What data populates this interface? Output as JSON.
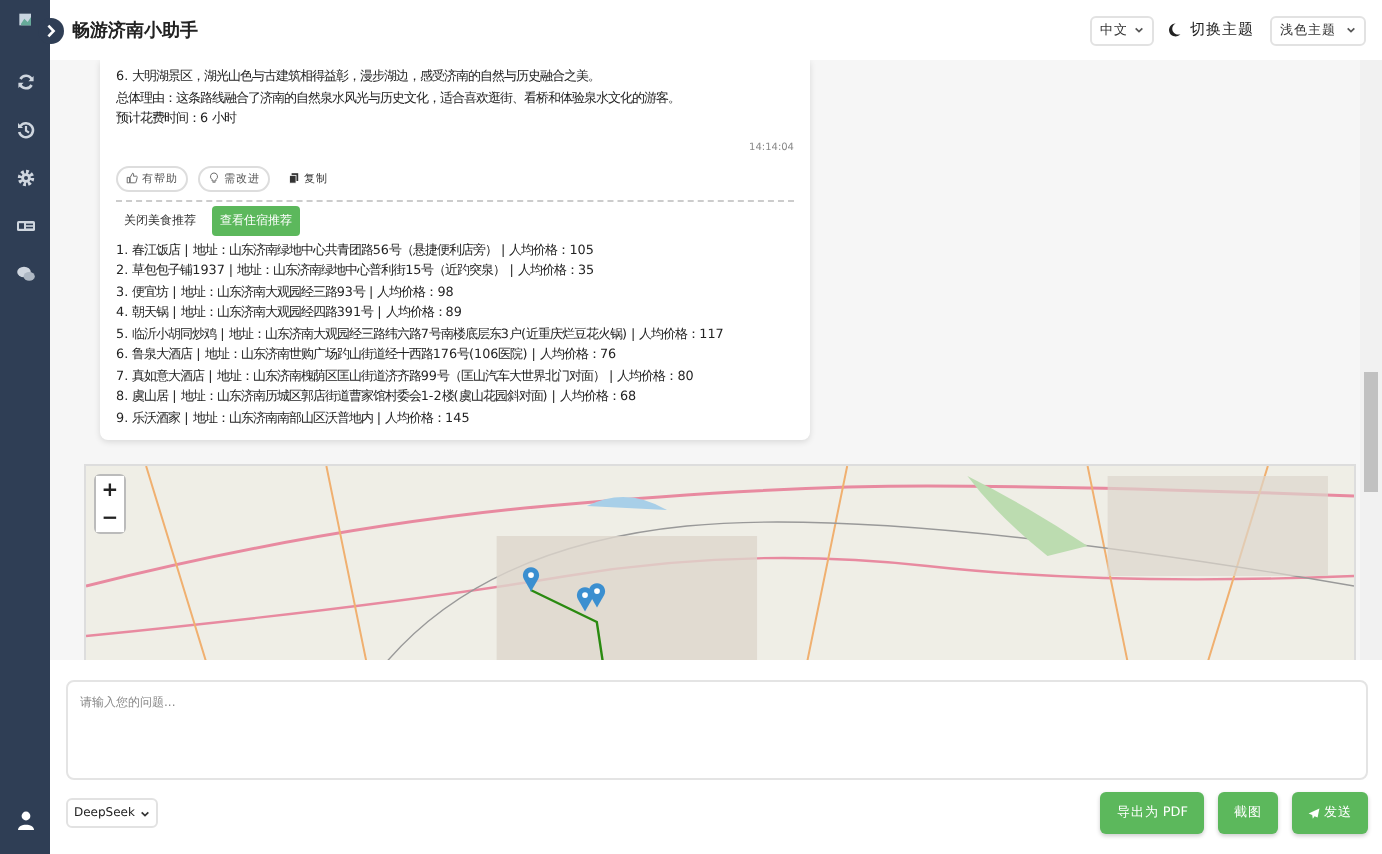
{
  "app": {
    "title": "畅游济南小助手"
  },
  "header": {
    "language": "中文",
    "theme_label": "切换主题",
    "theme": "浅色主题"
  },
  "message": {
    "lines": [
      "6. 大明湖景区，湖光山色与古建筑相得益彰，漫步湖边，感受济南的自然与历史融合之美。",
      "总体理由：这条路线融合了济南的自然泉水风光与历史文化，适合喜欢逛街、看桥和体验泉水文化的游客。",
      "预计花费时间：6 小时"
    ],
    "time": "14:14:04",
    "feedback": [
      {
        "kind": "helpful",
        "label": "有帮助"
      },
      {
        "kind": "improve",
        "label": "需改进"
      },
      {
        "kind": "copy",
        "label": "复制"
      }
    ],
    "recommend": [
      {
        "kind": "plain",
        "label": "关闭美食推荐"
      },
      {
        "kind": "primary",
        "label": "查看住宿推荐"
      }
    ],
    "restaurants": [
      "1. 春江饭店 | 地址：山东济南绿地中心共青团路56号（悬捷便利店旁） | 人均价格：105",
      "2. 草包包子铺1937 | 地址：山东济南绿地中心普利街15号（近趵突泉） | 人均价格：35",
      "3. 便宜坊 | 地址：山东济南大观园经三路93号 | 人均价格：98",
      "4. 朝天锅 | 地址：山东济南大观园经四路391号 | 人均价格：89",
      "5. 临沂小胡同炒鸡 | 地址：山东济南大观园经三路纬六路7号南楼底层东3户(近重庆烂豆花火锅) | 人均价格：117",
      "6. 鲁泉大酒店 | 地址：山东济南世购广场趵山街道经十西路176号(106医院) | 人均价格：76",
      "7. 真如意大酒店 | 地址：山东济南槐荫区匡山街道济齐路99号（匡山汽车大世界北门对面） | 人均价格：80",
      "8. 虞山居 | 地址：山东济南历城区郭店街道曹家馆村委会1-2楼(虞山花园斜对面) | 人均价格：68",
      "9. 乐沃酒家 | 地址：山东济南南部山区沃普地内 | 人均价格：145"
    ]
  },
  "map": {
    "zoom_in": "+",
    "zoom_out": "−"
  },
  "input": {
    "placeholder": "请输入您的问题..."
  },
  "model": "DeepSeek",
  "buttons": [
    {
      "kind": "export",
      "label": "导出为 PDF"
    },
    {
      "kind": "screenshot",
      "label": "截图"
    },
    {
      "kind": "send",
      "label": "发送"
    }
  ]
}
